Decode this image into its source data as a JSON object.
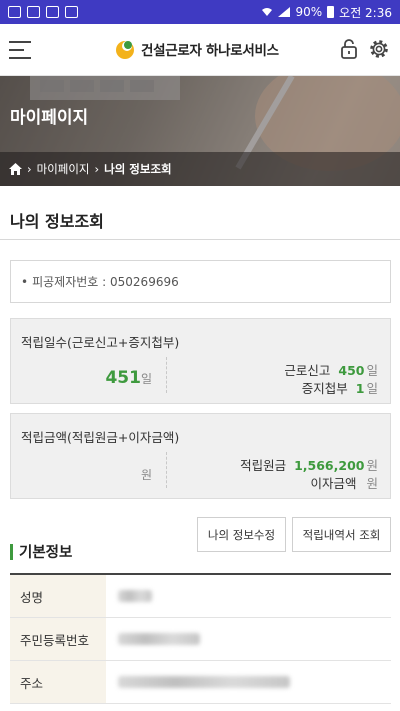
{
  "statusbar": {
    "battery": "90%",
    "time": "오전 2:36"
  },
  "app": {
    "logo_text": "건설근로자 하나로서비스"
  },
  "hero": {
    "title": "마이페이지"
  },
  "breadcrumb": {
    "level1": "마이페이지",
    "current": "나의 정보조회"
  },
  "page": {
    "title": "나의 정보조회"
  },
  "member": {
    "label": "피공제자번호 :",
    "value": "050269696"
  },
  "days": {
    "title": "적립일수(근로신고+증지첩부)",
    "total": "451",
    "total_unit": "일",
    "rows": [
      {
        "label": "근로신고",
        "value": "450",
        "unit": "일"
      },
      {
        "label": "증지첩부",
        "value": "1",
        "unit": "일"
      }
    ]
  },
  "amount": {
    "title": "적립금액(적립원금+이자금액)",
    "total": "",
    "total_unit": "원",
    "rows": [
      {
        "label": "적립원금",
        "value": "1,566,200",
        "unit": "원"
      },
      {
        "label": "이자금액",
        "value": "",
        "unit": "원"
      }
    ]
  },
  "buttons": {
    "edit": "나의 정보수정",
    "history": "적립내역서 조회"
  },
  "basic": {
    "title": "기본정보",
    "rows": [
      {
        "label": "성명"
      },
      {
        "label": "주민등록번호"
      },
      {
        "label": "주소"
      }
    ]
  },
  "colors": {
    "statusbar": "#3f3ac2",
    "accent": "#3e9a3e"
  },
  "icons": [
    "menu-icon",
    "lock-icon",
    "settings-gear-icon",
    "home-icon"
  ]
}
